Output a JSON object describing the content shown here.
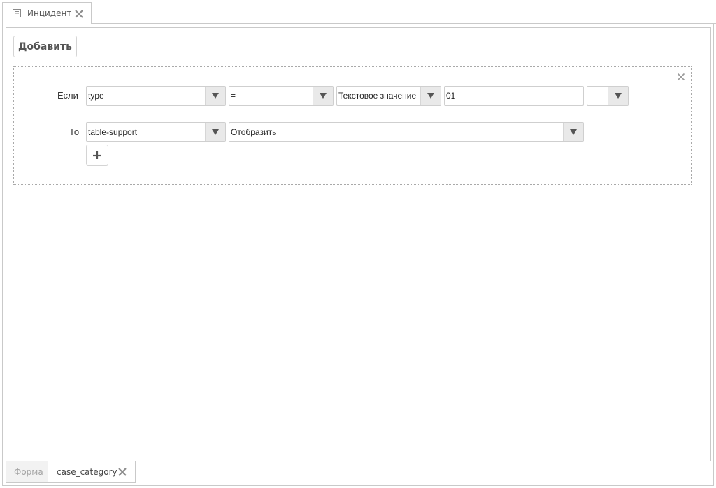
{
  "top_tab": {
    "title": "Инцидент",
    "icon": "document-icon"
  },
  "toolbar": {
    "add_label": "Добавить"
  },
  "rule": {
    "if_label": "Если",
    "then_label": "То",
    "condition": {
      "field": "type",
      "operator": "=",
      "value_type": "Текстовое значение",
      "value": "01",
      "extra": ""
    },
    "action": {
      "target": "table-support",
      "operation": "Отобразить"
    }
  },
  "bottom_tabs": {
    "form": "Форма",
    "category": "case_category"
  },
  "colors": {
    "border": "#c9c9c9",
    "dropdown_button": "#e9e9e9",
    "inactive_tab_bg": "#f2f2f2",
    "inactive_tab_text": "#a5a5a5"
  }
}
